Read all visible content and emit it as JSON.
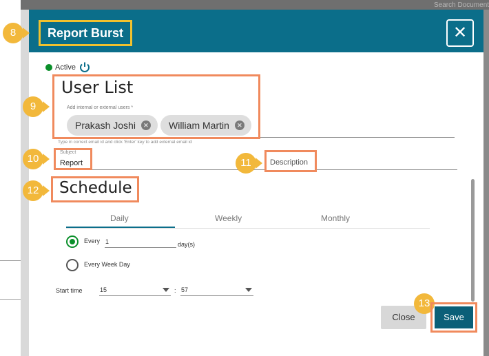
{
  "background": {
    "search_placeholder": "Search Document"
  },
  "dialog": {
    "title": "Report Burst",
    "close_icon": "close-icon"
  },
  "markers": {
    "m8": "8",
    "m9": "9",
    "m10": "10",
    "m11": "11",
    "m12": "12",
    "m13": "13"
  },
  "status": {
    "label": "Active",
    "icon": "power-icon",
    "dot_color": "#0a8f2a"
  },
  "user_list": {
    "title": "User List",
    "add_label": "Add internal or external users *",
    "chips": [
      {
        "name": "Prakash Joshi"
      },
      {
        "name": "William Martin"
      }
    ],
    "hint": "Type in correct email id and click 'Enter' key to add external email id"
  },
  "subject": {
    "label": "Subject",
    "value": "Report"
  },
  "description": {
    "label": "Description"
  },
  "schedule": {
    "title": "Schedule",
    "tabs": [
      "Daily",
      "Weekly",
      "Monthly"
    ],
    "active_tab": "Daily",
    "every_label": "Every",
    "every_value": "1",
    "every_unit": "day(s)",
    "every_week_day_label": "Every Week Day",
    "start_time_label": "Start time",
    "hour_value": "15",
    "separator": ":",
    "minute_value": "57"
  },
  "footer": {
    "close_label": "Close",
    "save_label": "Save"
  },
  "colors": {
    "header": "#0b6e8a",
    "highlight_title": "#f2c12e",
    "highlight_box": "#f08a5d",
    "marker": "#f2b83b",
    "save": "#0b5f78"
  }
}
